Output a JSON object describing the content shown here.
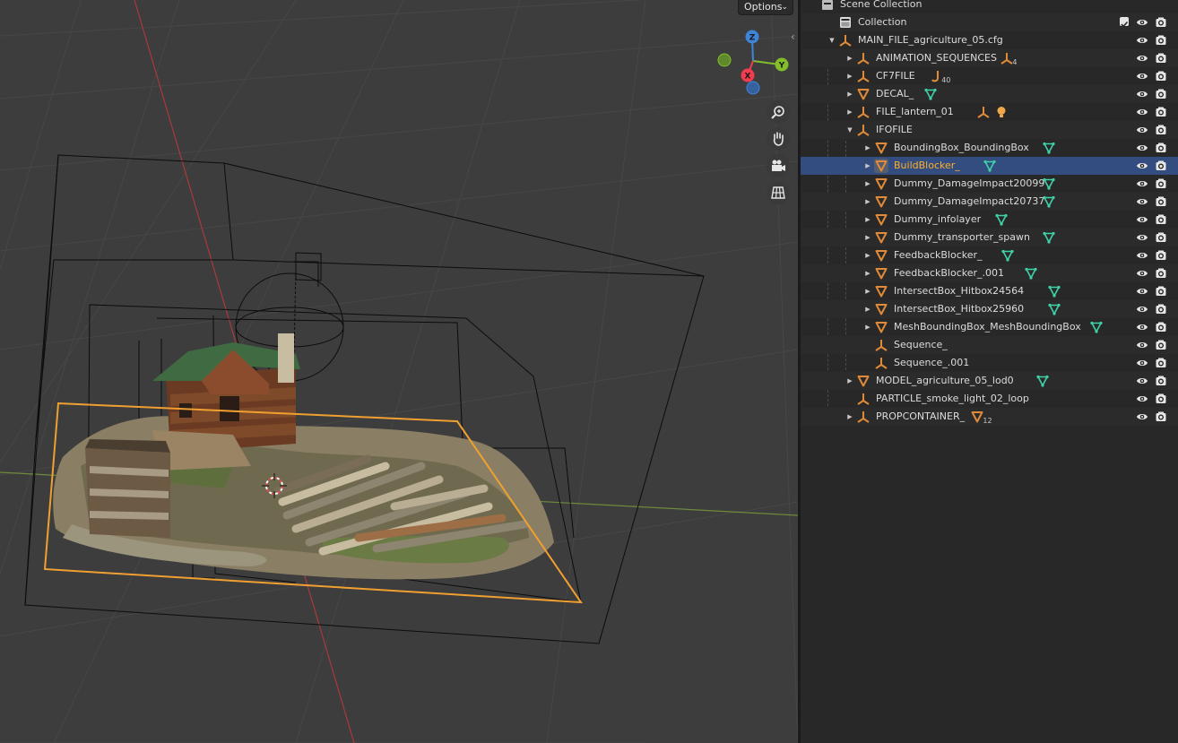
{
  "viewport": {
    "options_label": "Options",
    "gizmo": {
      "z_label": "Z",
      "y_label": "Y",
      "x_label": "X"
    },
    "nav_buttons": [
      "zoom-icon",
      "hand-pan-icon",
      "camera-icon",
      "grid-ortho-icon"
    ],
    "colors": {
      "background": "#3d3d3d",
      "selection": "#f0a030",
      "x_axis": "#b03a3a",
      "y_axis": "#7aa33a",
      "gizmo_x": "#f33c4f",
      "gizmo_y": "#83bd2a",
      "gizmo_z": "#3e85d8"
    }
  },
  "outliner": {
    "rows": [
      {
        "label": "Scene Collection",
        "icon": "scene-collection-icon",
        "depth": 0,
        "arrow": "",
        "selected": false,
        "vis": false
      },
      {
        "label": "Collection",
        "icon": "collection-icon",
        "depth": 1,
        "arrow": "",
        "selected": false,
        "vis": true,
        "checkbox": true
      },
      {
        "label": "MAIN_FILE_agriculture_05.cfg",
        "icon": "empty-icon",
        "depth": 1,
        "arrow": "down",
        "selected": false,
        "vis": true
      },
      {
        "label": "ANIMATION_SEQUENCES",
        "icon": "empty-icon",
        "depth": 2,
        "arrow": "right",
        "selected": false,
        "vis": true,
        "extra": "empty-icon",
        "count": "4"
      },
      {
        "label": "CF7FILE",
        "icon": "empty-icon",
        "depth": 2,
        "arrow": "right",
        "selected": false,
        "vis": true,
        "extra": "bone-icon",
        "count": "40"
      },
      {
        "label": "DECAL_",
        "icon": "mesh-icon",
        "depth": 2,
        "arrow": "right",
        "selected": false,
        "vis": true,
        "extra": "mesh-data-icon"
      },
      {
        "label": "FILE_lantern_01",
        "icon": "empty-icon",
        "depth": 2,
        "arrow": "right",
        "selected": false,
        "vis": true,
        "extra": "empty-icon",
        "extra2": "light-icon"
      },
      {
        "label": "IFOFILE",
        "icon": "empty-icon",
        "depth": 2,
        "arrow": "down",
        "selected": false,
        "vis": true
      },
      {
        "label": "BoundingBox_BoundingBox",
        "icon": "mesh-icon",
        "depth": 3,
        "arrow": "right",
        "selected": false,
        "vis": true,
        "extra": "mesh-data-icon"
      },
      {
        "label": "BuildBlocker_",
        "icon": "mesh-icon",
        "depth": 3,
        "arrow": "right",
        "selected": true,
        "vis": true,
        "extra": "mesh-data-icon"
      },
      {
        "label": "Dummy_DamageImpact20099",
        "icon": "mesh-icon",
        "depth": 3,
        "arrow": "right",
        "selected": false,
        "vis": true,
        "extra": "mesh-data-icon"
      },
      {
        "label": "Dummy_DamageImpact20737",
        "icon": "mesh-icon",
        "depth": 3,
        "arrow": "right",
        "selected": false,
        "vis": true,
        "extra": "mesh-data-icon"
      },
      {
        "label": "Dummy_infolayer",
        "icon": "mesh-icon",
        "depth": 3,
        "arrow": "right",
        "selected": false,
        "vis": true,
        "extra": "mesh-data-icon"
      },
      {
        "label": "Dummy_transporter_spawn",
        "icon": "mesh-icon",
        "depth": 3,
        "arrow": "right",
        "selected": false,
        "vis": true,
        "extra": "mesh-data-icon"
      },
      {
        "label": "FeedbackBlocker_",
        "icon": "mesh-icon",
        "depth": 3,
        "arrow": "right",
        "selected": false,
        "vis": true,
        "extra": "mesh-data-icon"
      },
      {
        "label": "FeedbackBlocker_.001",
        "icon": "mesh-icon",
        "depth": 3,
        "arrow": "right",
        "selected": false,
        "vis": true,
        "extra": "mesh-data-icon"
      },
      {
        "label": "IntersectBox_Hitbox24564",
        "icon": "mesh-icon",
        "depth": 3,
        "arrow": "right",
        "selected": false,
        "vis": true,
        "extra": "mesh-data-icon"
      },
      {
        "label": "IntersectBox_Hitbox25960",
        "icon": "mesh-icon",
        "depth": 3,
        "arrow": "right",
        "selected": false,
        "vis": true,
        "extra": "mesh-data-icon"
      },
      {
        "label": "MeshBoundingBox_MeshBoundingBox",
        "icon": "mesh-icon",
        "depth": 3,
        "arrow": "right",
        "selected": false,
        "vis": true,
        "extra": "mesh-data-icon"
      },
      {
        "label": "Sequence_",
        "icon": "empty-icon",
        "depth": 3,
        "arrow": "",
        "selected": false,
        "vis": true
      },
      {
        "label": "Sequence_.001",
        "icon": "empty-icon",
        "depth": 3,
        "arrow": "",
        "selected": false,
        "vis": true
      },
      {
        "label": "MODEL_agriculture_05_lod0",
        "icon": "mesh-icon",
        "depth": 2,
        "arrow": "right",
        "selected": false,
        "vis": true,
        "extra": "mesh-data-icon"
      },
      {
        "label": "PARTICLE_smoke_light_02_loop",
        "icon": "empty-icon",
        "depth": 2,
        "arrow": "",
        "selected": false,
        "vis": true
      },
      {
        "label": "PROPCONTAINER_",
        "icon": "empty-icon",
        "depth": 2,
        "arrow": "right",
        "selected": false,
        "vis": true,
        "extra": "mesh-icon",
        "count": "12"
      }
    ],
    "colors": {
      "object": "#e08a3a",
      "mesh_data": "#3fd1a8",
      "light": "#f2a64a",
      "selected_text": "#ffaf29",
      "selected_row": "#334d80"
    }
  }
}
